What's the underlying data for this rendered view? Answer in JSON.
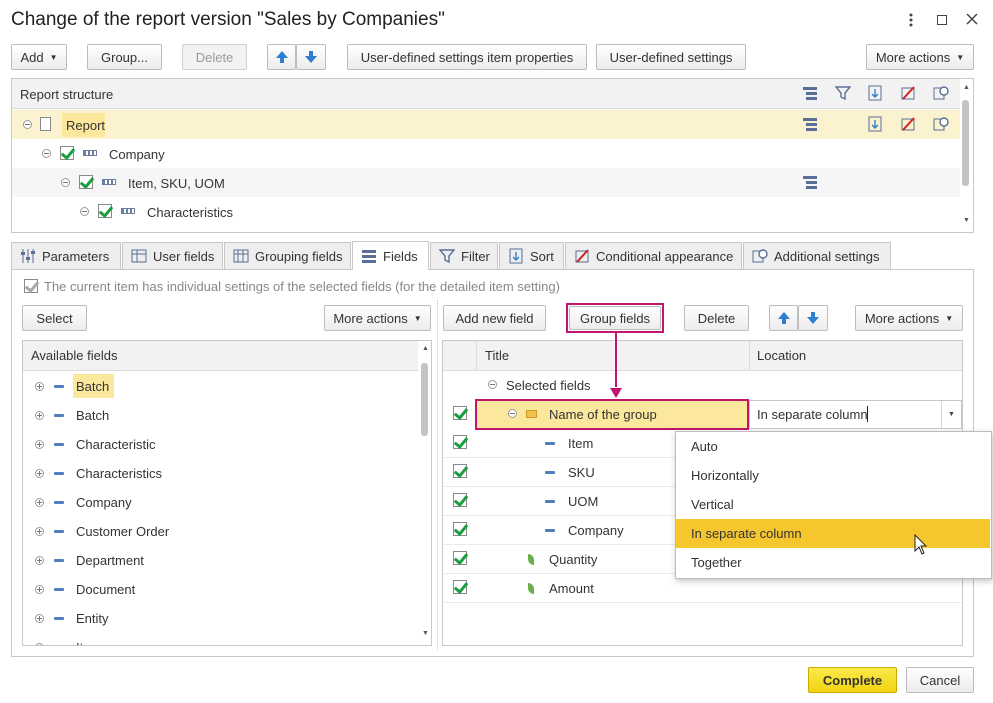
{
  "window": {
    "title": "Change of the report version \"Sales by Companies\""
  },
  "toolbar": {
    "add": "Add",
    "group": "Group...",
    "delete": "Delete",
    "item_properties": "User-defined settings item properties",
    "user_settings": "User-defined settings",
    "more_actions": "More actions"
  },
  "structure": {
    "header": "Report structure",
    "rows": [
      {
        "label": "Report"
      },
      {
        "label": "Company"
      },
      {
        "label": "Item, SKU, UOM"
      },
      {
        "label": "Characteristics"
      }
    ]
  },
  "tabs": [
    {
      "label": "Parameters"
    },
    {
      "label": "User fields"
    },
    {
      "label": "Grouping fields"
    },
    {
      "label": "Fields"
    },
    {
      "label": "Filter"
    },
    {
      "label": "Sort"
    },
    {
      "label": "Conditional appearance"
    },
    {
      "label": "Additional settings"
    }
  ],
  "fields_tab": {
    "individual_settings": "The current item has individual settings of the selected fields (for the detailed item setting)",
    "select": "Select",
    "more_actions_left": "More actions",
    "add_new_field": "Add new field",
    "group_fields": "Group fields",
    "delete": "Delete",
    "more_actions_right": "More actions",
    "available_header": "Available fields",
    "available": [
      "Batch",
      "Batch",
      "Characteristic",
      "Characteristics",
      "Company",
      "Customer Order",
      "Department",
      "Document",
      "Entity",
      "Item"
    ],
    "col_title": "Title",
    "col_location": "Location",
    "selected_root": "Selected fields",
    "selected": [
      {
        "title": "Name of the group",
        "location": "In separate column"
      },
      {
        "title": "Item"
      },
      {
        "title": "SKU"
      },
      {
        "title": "UOM"
      },
      {
        "title": "Company"
      },
      {
        "title": "Quantity"
      },
      {
        "title": "Amount"
      }
    ],
    "location_options": [
      "Auto",
      "Horizontally",
      "Vertical",
      "In separate column",
      "Together"
    ]
  },
  "footer": {
    "complete": "Complete",
    "cancel": "Cancel"
  },
  "colors": {
    "accent_yellow": "#fbe89c",
    "highlight_magenta": "#c0166f",
    "selected_option": "#f6c62e",
    "complete_button": "#f8e11c"
  }
}
